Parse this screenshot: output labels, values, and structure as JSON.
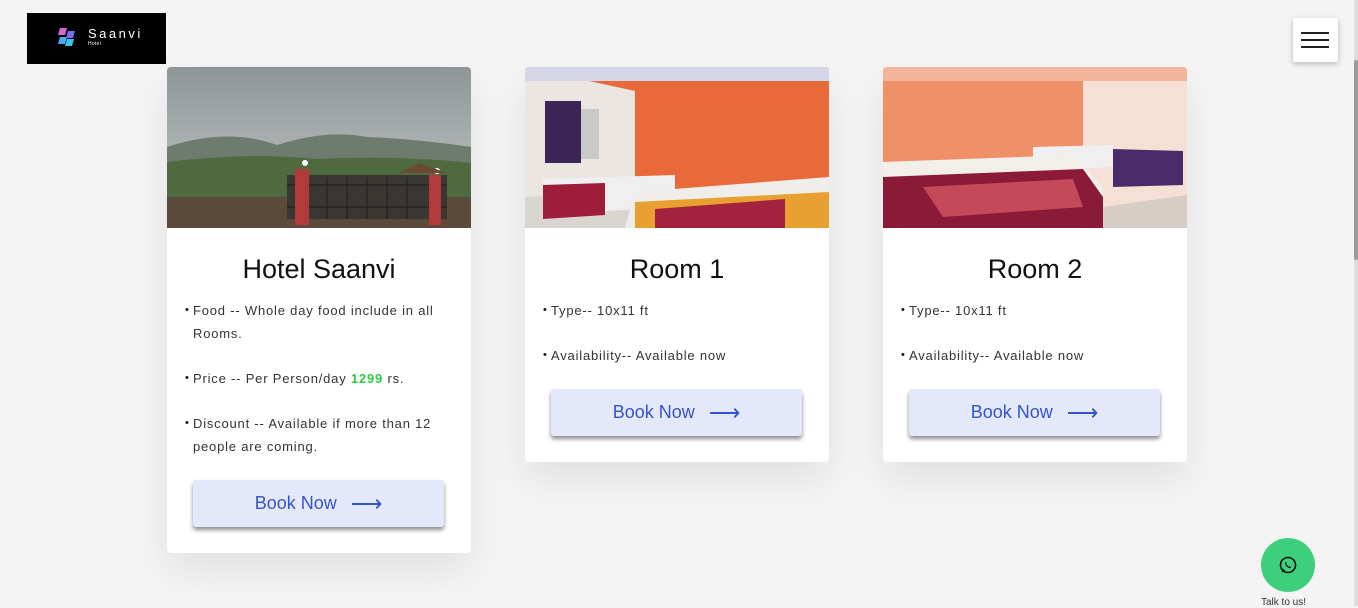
{
  "brand": {
    "name": "Saanvi",
    "subtitle": "Hotel"
  },
  "cards": [
    {
      "image": "hotel-exterior-image",
      "title": "Hotel Saanvi",
      "items": [
        {
          "text": "Food -- Whole day food include in all Rooms."
        },
        {
          "prefix": "Price -- Per Person/day ",
          "highlight": "1299",
          "suffix": " rs."
        },
        {
          "text": "Discount -- Available if more than 12 people are coming."
        }
      ],
      "button": "Book Now"
    },
    {
      "image": "room-1-image",
      "title": "Room 1",
      "items": [
        {
          "text": "Type-- 10x11 ft"
        },
        {
          "text": "Availability-- Available now"
        }
      ],
      "button": "Book Now"
    },
    {
      "image": "room-2-image",
      "title": "Room 2",
      "items": [
        {
          "text": "Type-- 10x11 ft"
        },
        {
          "text": "Availability-- Available now"
        }
      ],
      "button": "Book Now"
    }
  ],
  "whatsapp": {
    "label": "Talk to us!",
    "color": "#3ecf7d"
  },
  "icons": {
    "menu": "hamburger-menu-icon",
    "whatsapp": "whatsapp-icon",
    "arrow": "arrow-right-icon"
  },
  "colors": {
    "price_highlight": "#2ecc40",
    "button_text": "#3554c9",
    "button_bg": "#e4e8fb"
  }
}
